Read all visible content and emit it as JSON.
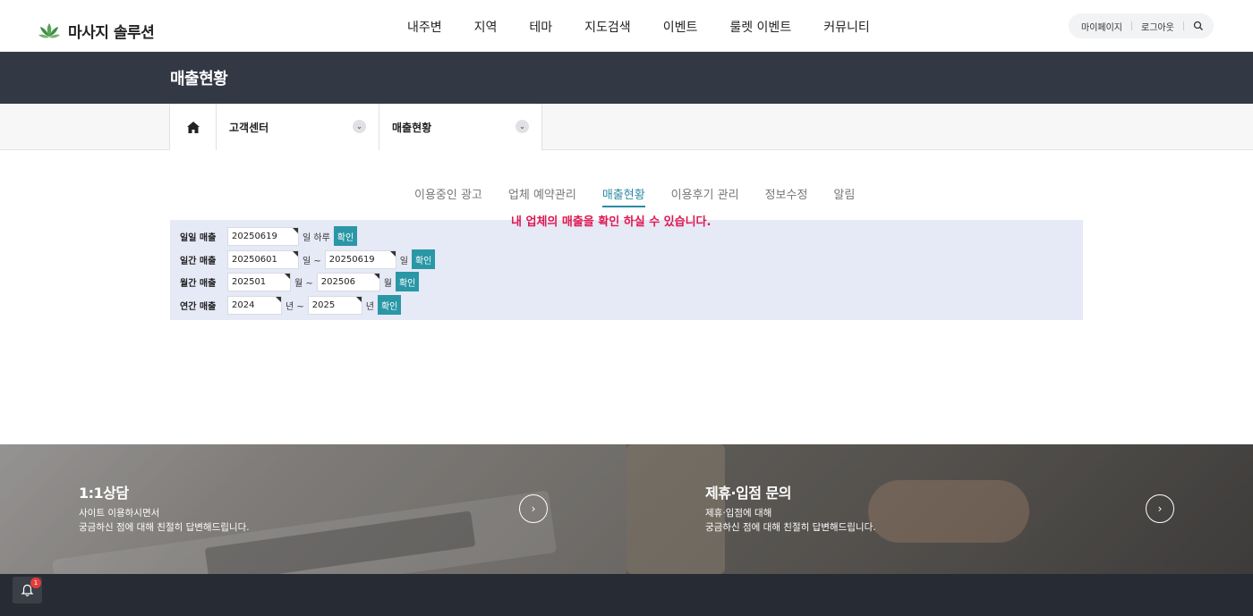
{
  "header": {
    "logo_text": "마사지 솔루션",
    "nav": [
      "내주변",
      "지역",
      "테마",
      "지도검색",
      "이벤트",
      "룰렛 이벤트",
      "커뮤니티"
    ],
    "util": {
      "mypage": "마이페이지",
      "logout": "로그아웃"
    }
  },
  "page_title": "매출현황",
  "breadcrumb": {
    "level1": "고객센터",
    "level2": "매출현황"
  },
  "tabs": [
    "이용중인 광고",
    "업체 예약관리",
    "매출현황",
    "이용후기 관리",
    "정보수정",
    "알림"
  ],
  "active_tab": "매출현황",
  "notice": "내 업체의 매출을 확인 하실 수 있습니다.",
  "sales": {
    "daily": {
      "label": "일일 매출",
      "date": "20250619",
      "suffix": "일 하루",
      "button": "확인"
    },
    "period": {
      "label": "일간 매출",
      "from": "20250601",
      "from_suffix": "일 ~",
      "to": "20250619",
      "to_suffix": "일",
      "button": "확인"
    },
    "monthly": {
      "label": "월간 매출",
      "from": "202501",
      "from_suffix": "월 ~",
      "to": "202506",
      "to_suffix": "월",
      "button": "확인"
    },
    "yearly": {
      "label": "연간 매출",
      "from": "2024",
      "from_suffix": "년 ~",
      "to": "2025",
      "to_suffix": "년",
      "button": "확인"
    }
  },
  "banners": {
    "consult": {
      "title": "1:1상담",
      "line1": "사이트 이용하시면서",
      "line2": "궁금하신 점에 대해 친절히 답변해드립니다."
    },
    "partner": {
      "title": "제휴·입점 문의",
      "line1": "제휴·입점에 대해",
      "line2": "궁금하신 점에 대해 친절히 답변해드립니다."
    }
  },
  "notification_count": "1",
  "colors": {
    "accent": "#2a97a6",
    "notice": "#e0174f",
    "titlebar": "#333845",
    "panel": "#e6e9f6"
  }
}
